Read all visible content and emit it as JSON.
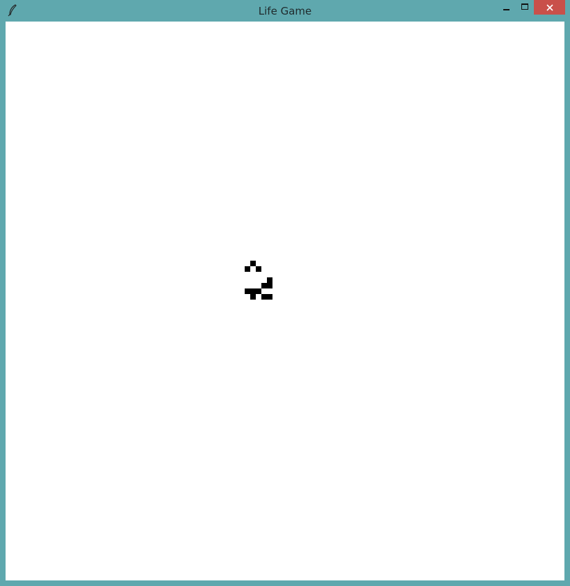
{
  "window": {
    "title": "Life Game",
    "icons": {
      "app": "feather-icon",
      "minimize": "minimize-icon",
      "maximize": "maximize-icon",
      "close": "close-icon"
    },
    "colors": {
      "frame": "#5fa8ae",
      "close_button": "#c9504a",
      "close_glyph": "#ffffff",
      "canvas": "#ffffff",
      "cell": "#000000"
    }
  },
  "board": {
    "alive_cells": [
      [
        44,
        0
      ],
      [
        43,
        1
      ],
      [
        45,
        1
      ],
      [
        47,
        3
      ],
      [
        46,
        4
      ],
      [
        47,
        4
      ],
      [
        43,
        5
      ],
      [
        44,
        5
      ],
      [
        45,
        5
      ],
      [
        44,
        6
      ],
      [
        46,
        6
      ],
      [
        47,
        6
      ]
    ]
  }
}
